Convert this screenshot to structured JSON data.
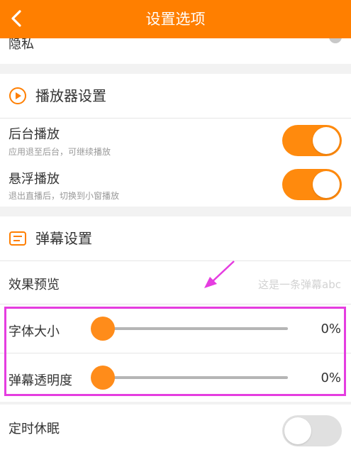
{
  "header": {
    "title": "设置选项",
    "back_icon": "chevron-left-icon"
  },
  "privacy": {
    "label": "隐私"
  },
  "player_section": {
    "title": "播放器设置",
    "icon": "play-circle-icon",
    "background_play": {
      "label": "后台播放",
      "desc": "应用退至后台，可继续播放",
      "enabled": true
    },
    "float_play": {
      "label": "悬浮播放",
      "desc": "退出直播后，切换到小窗播放",
      "enabled": true
    }
  },
  "danmaku_section": {
    "title": "弹幕设置",
    "icon": "danmaku-list-icon",
    "preview": {
      "label": "效果预览",
      "sample": "这是一条弹幕abc"
    },
    "font_size": {
      "label": "字体大小",
      "value": "0%"
    },
    "opacity": {
      "label": "弹幕透明度",
      "value": "0%"
    }
  },
  "sleep_timer": {
    "label": "定时休眠",
    "enabled": false
  },
  "colors": {
    "accent": "#ff7f00",
    "highlight": "#e53de0"
  }
}
